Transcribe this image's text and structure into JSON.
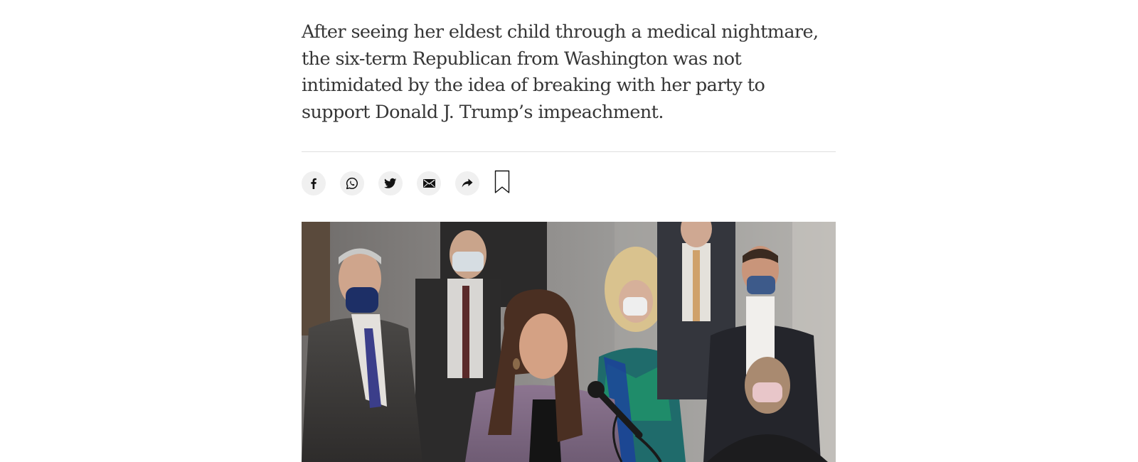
{
  "article": {
    "summary": "After seeing her eldest child through a medical nightmare, the six-term Republican from Washington was not intimidated by the idea of breaking with her party to support Donald J. Trump’s impeachment."
  },
  "share_bar": {
    "buttons": [
      {
        "name": "facebook",
        "icon": "facebook-icon"
      },
      {
        "name": "whatsapp",
        "icon": "whatsapp-icon"
      },
      {
        "name": "twitter",
        "icon": "twitter-icon"
      },
      {
        "name": "email",
        "icon": "email-icon"
      },
      {
        "name": "share",
        "icon": "share-arrow-icon"
      }
    ],
    "bookmark_icon": "bookmark-icon"
  },
  "colors": {
    "text": "#363636",
    "divider": "#dfdfdf",
    "icon_bg": "#f0f0f0",
    "icon": "#121212"
  }
}
